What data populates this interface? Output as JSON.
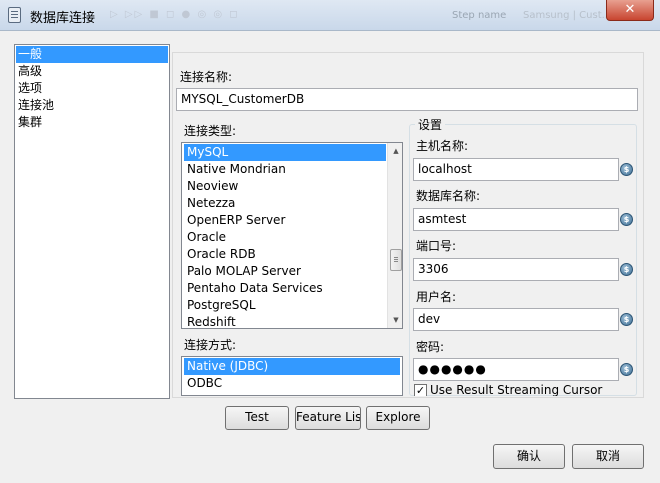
{
  "window": {
    "title": "数据库连接",
    "close_label": "✕",
    "bg_ghost_toolbar": "▷ ▷▷ ■ ◻ ● ◎ ◎ ◻",
    "bg_ghost_step": "Step name",
    "bg_ghost_field": "Samsung | Cust..."
  },
  "nav": {
    "items": [
      {
        "label": "一般",
        "selected": true
      },
      {
        "label": "高级",
        "selected": false
      },
      {
        "label": "选项",
        "selected": false
      },
      {
        "label": "连接池",
        "selected": false
      },
      {
        "label": "集群",
        "selected": false
      }
    ]
  },
  "form": {
    "conn_name_label": "连接名称:",
    "conn_name_value": "MYSQL_CustomerDB",
    "conn_type_label": "连接类型:",
    "conn_types": [
      {
        "label": "MySQL",
        "selected": true
      },
      {
        "label": "Native Mondrian",
        "selected": false
      },
      {
        "label": "Neoview",
        "selected": false
      },
      {
        "label": "Netezza",
        "selected": false
      },
      {
        "label": "OpenERP Server",
        "selected": false
      },
      {
        "label": "Oracle",
        "selected": false
      },
      {
        "label": "Oracle RDB",
        "selected": false
      },
      {
        "label": "Palo MOLAP Server",
        "selected": false
      },
      {
        "label": "Pentaho Data Services",
        "selected": false
      },
      {
        "label": "PostgreSQL",
        "selected": false
      },
      {
        "label": "Redshift",
        "selected": false
      }
    ],
    "access_label": "连接方式:",
    "access_types": [
      {
        "label": "Native (JDBC)",
        "selected": true
      },
      {
        "label": "ODBC",
        "selected": false
      }
    ]
  },
  "settings": {
    "title": "设置",
    "host_label": "主机名称:",
    "host_value": "localhost",
    "db_label": "数据库名称:",
    "db_value": "asmtest",
    "port_label": "端口号:",
    "port_value": "3306",
    "user_label": "用户名:",
    "user_value": "dev",
    "password_label": "密码:",
    "password_value": "●●●●●●",
    "streaming_label": "Use Result Streaming Cursor",
    "streaming_checked": true,
    "var_icon_glyph": "$"
  },
  "actions": {
    "test": "Test",
    "feature_list": "Feature List",
    "explore": "Explore",
    "ok": "确认",
    "cancel": "取消"
  }
}
